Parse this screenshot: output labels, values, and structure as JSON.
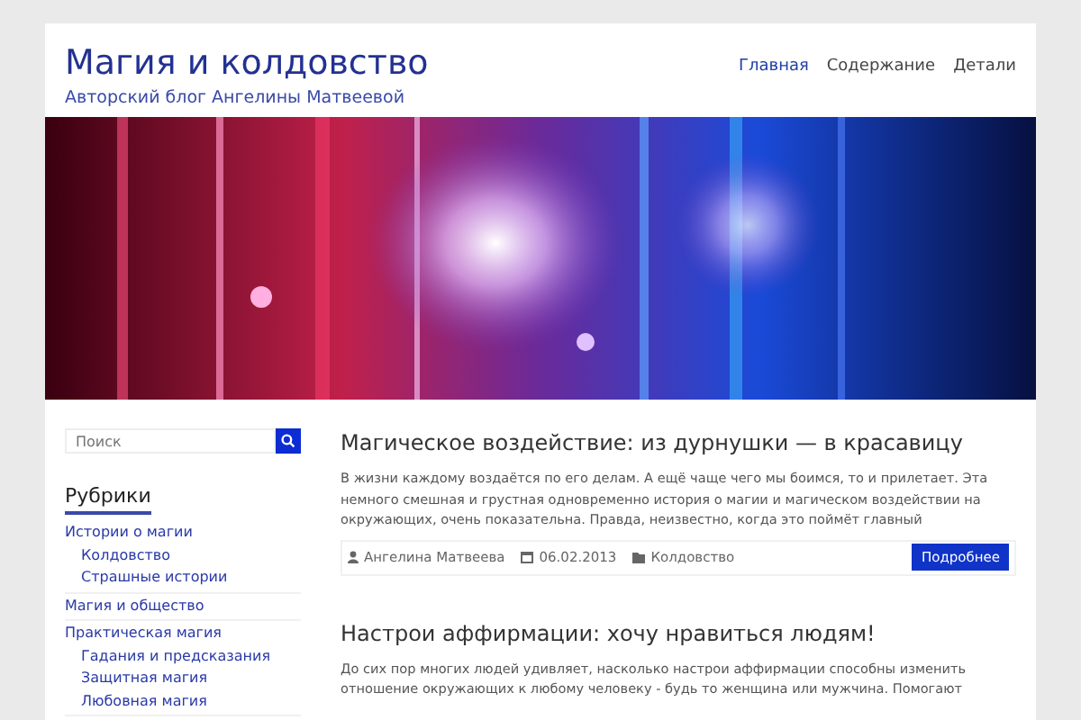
{
  "site": {
    "title": "Магия и колдовство",
    "tagline": "Авторский блог Ангелины Матвеевой"
  },
  "nav": [
    {
      "label": "Главная",
      "selected": true
    },
    {
      "label": "Содержание",
      "selected": false
    },
    {
      "label": "Детали",
      "selected": false
    }
  ],
  "search": {
    "placeholder": "Поиск"
  },
  "categories": {
    "title": "Рубрики",
    "items": [
      {
        "label": "Истории о магии",
        "children": [
          {
            "label": "Колдовство"
          },
          {
            "label": "Страшные истории"
          }
        ]
      },
      {
        "label": "Магия и общество"
      },
      {
        "label": "Практическая магия",
        "children": [
          {
            "label": "Гадания и предсказания"
          },
          {
            "label": "Защитная магия"
          },
          {
            "label": "Любовная магия"
          }
        ]
      }
    ]
  },
  "posts": [
    {
      "title": "Магическое воздействие: из дурнушки — в красавицу",
      "excerpt": " В жизни каждому воздаётся по его делам. А ещё чаще чего мы боимся, то и прилетает. Эта немного смешная и грустная одновременно история о магии и магическом воздействии на окружающих, очень показательна.  Правда, неизвестно, когда это поймёт главный",
      "author": "Ангелина Матвеева",
      "date": "06.02.2013",
      "category": "Колдовство",
      "more": "Подробнее"
    },
    {
      "title": "Настрои аффирмации: хочу нравиться людям!",
      "excerpt": "До сих пор многих людей удивляет, насколько настрои аффирмации способны изменить отношение окружающих к любому человеку - будь то женщина или мужчина. Помогают"
    }
  ]
}
